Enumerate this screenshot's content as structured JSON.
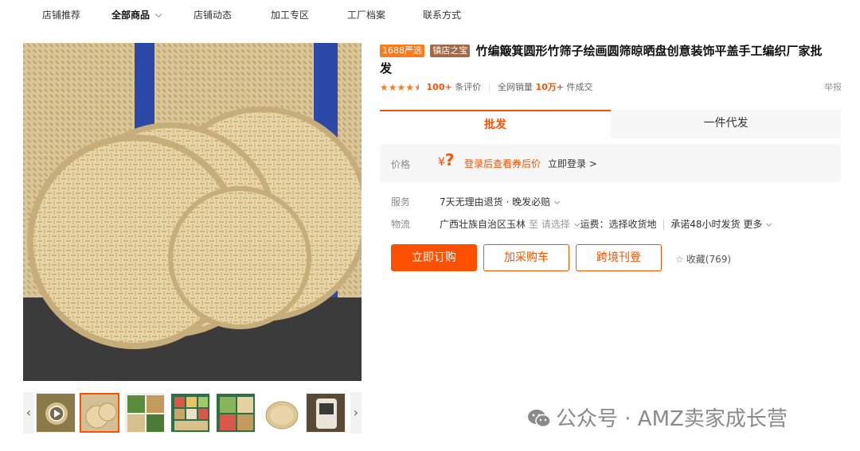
{
  "nav": {
    "items": [
      {
        "label": "店铺推荐"
      },
      {
        "label": "全部商品"
      },
      {
        "label": "店铺动态"
      },
      {
        "label": "加工专区"
      },
      {
        "label": "工厂档案"
      },
      {
        "label": "联系方式"
      }
    ],
    "active_index": 1
  },
  "product": {
    "tag_1688": "1688严选",
    "tag_shop": "镇店之宝",
    "title": "竹编簸箕圆形竹筛子绘画圆筛晾晒盘创意装饰平盖手工编织厂家批发",
    "rating_stars": 4.5,
    "review_count": "100+",
    "review_label": "条评价",
    "sales_label": "全网销量",
    "sales_count": "10万+",
    "sales_unit": "件成交",
    "report_label": "举报"
  },
  "tabs": {
    "wholesale": "批发",
    "dropship": "一件代发"
  },
  "price": {
    "label": "价格",
    "yen": "¥",
    "value": "?",
    "tip": "登录后查看券后价",
    "login": "立即登录 >"
  },
  "service": {
    "label": "服务",
    "value": "7天无理由退货 · 晚发必赔"
  },
  "logistics": {
    "label": "物流",
    "origin": "广西壮族自治区玉林",
    "to": "至",
    "select": "请选择",
    "freight": "运费：选择收货地",
    "promise": "承诺48小时发货",
    "more": "更多"
  },
  "actions": {
    "order": "立即订购",
    "cart": "加采购车",
    "cross": "跨境刊登",
    "favorite": "收藏(769)"
  },
  "thumbnails": {
    "selected_index": 1,
    "count": 7
  },
  "watermark": "公众号 · AMZ卖家成长营",
  "colors": {
    "accent": "#ff5000",
    "star": "#ff7a1a",
    "price_bg": "#f7f7f7"
  }
}
